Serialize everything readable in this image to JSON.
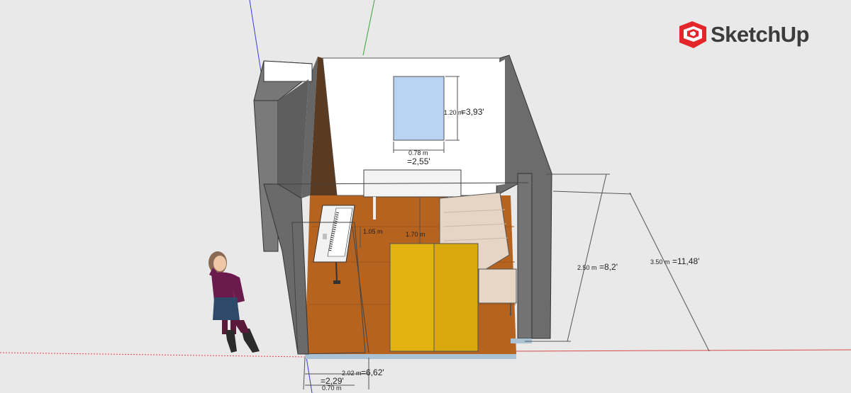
{
  "app": {
    "name": "SketchUp",
    "logo_icon": "sketchup-logo-icon",
    "logo_color": "#e4262b"
  },
  "colors": {
    "background": "#e9e9e9",
    "wall_dark": "#6c6c6c",
    "floor": "#b5631f",
    "window": "#b9d3f3",
    "cabinet": "#e3b210",
    "sofa": "#e6d5c4",
    "axis_red": "#d94a4a",
    "axis_green": "#3aa33a",
    "axis_blue": "#3b3bd8"
  },
  "dimensions": {
    "window_height_m": "1.20 m",
    "window_height_ft": "=3,93'",
    "window_width_m": "0.78 m",
    "window_width_ft": "=2,55'",
    "keyboard_distance_m": "1.05 m",
    "desk_distance_m": "1.70 m",
    "room_height_m": "2.50 m",
    "room_height_ft": "=8,2'",
    "room_depth_m": "3.50 m",
    "room_depth_ft": "=11,48'",
    "room_width_m": "2.02 m",
    "room_width_ft": "=6,62'",
    "door_width_m": "0.70 m",
    "door_width_ft": "=2,29'"
  }
}
